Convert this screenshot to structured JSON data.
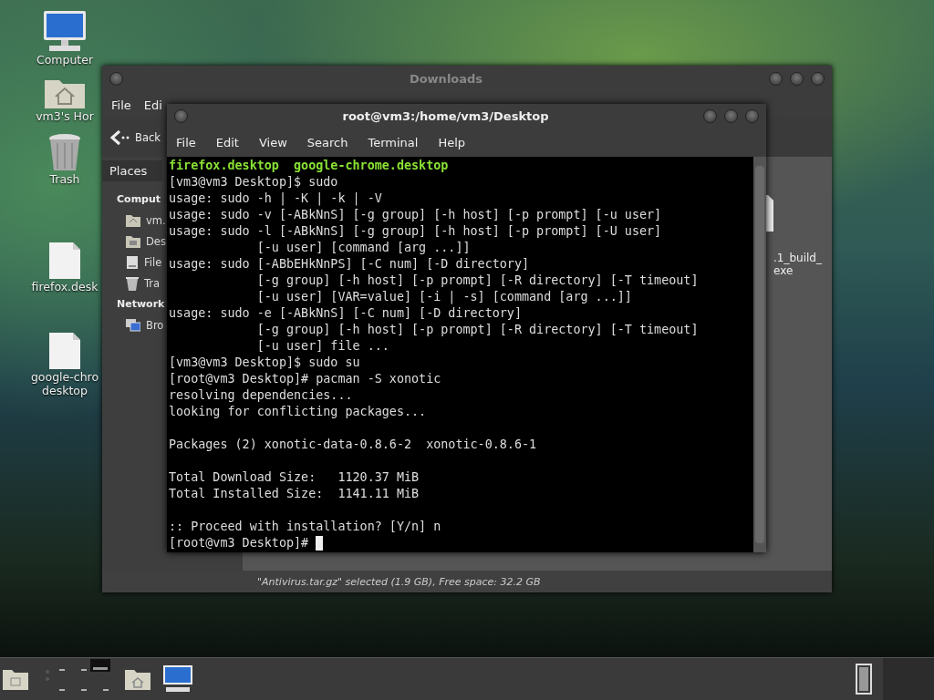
{
  "desktop_icons": [
    {
      "kind": "computer",
      "label": [
        "Computer"
      ]
    },
    {
      "kind": "home",
      "label": [
        "vm3's Hor"
      ]
    },
    {
      "kind": "trash",
      "label": [
        "Trash"
      ]
    },
    {
      "kind": "file",
      "label": [
        "firefox.desk"
      ]
    },
    {
      "kind": "file",
      "label": [
        "google-chro",
        "desktop"
      ]
    }
  ],
  "file_manager": {
    "title": "Downloads",
    "menu": [
      "File",
      "Edi"
    ],
    "back": "Back",
    "sidebar_tab": "Places",
    "sidebar": [
      {
        "kind": "heading",
        "label": "Comput"
      },
      {
        "kind": "home",
        "label": "vm."
      },
      {
        "kind": "desktop",
        "label": "Des"
      },
      {
        "kind": "drive",
        "label": "File"
      },
      {
        "kind": "trash",
        "label": "Tra"
      },
      {
        "kind": "heading",
        "label": "Network"
      },
      {
        "kind": "network",
        "label": "Bro"
      }
    ],
    "files": [
      {
        "label": [
          ".1_build_",
          "exe"
        ]
      }
    ],
    "status_bar": "\"Antivirus.tar.gz\" selected (1.9 GB), Free space: 32.2 GB"
  },
  "terminal": {
    "title": "root@vm3:/home/vm3/Desktop",
    "menu": [
      "File",
      "Edit",
      "View",
      "Search",
      "Terminal",
      "Help"
    ],
    "lines": [
      {
        "kind": "listing",
        "text": "firefox.desktop  google-chrome.desktop"
      },
      {
        "kind": "plain",
        "text": "[vm3@vm3 Desktop]$ sudo"
      },
      {
        "kind": "plain",
        "text": "usage: sudo -h | -K | -k | -V"
      },
      {
        "kind": "plain",
        "text": "usage: sudo -v [-ABkNnS] [-g group] [-h host] [-p prompt] [-u user]"
      },
      {
        "kind": "plain",
        "text": "usage: sudo -l [-ABkNnS] [-g group] [-h host] [-p prompt] [-U user]"
      },
      {
        "kind": "plain",
        "text": "            [-u user] [command [arg ...]]"
      },
      {
        "kind": "plain",
        "text": "usage: sudo [-ABbEHkNnPS] [-C num] [-D directory]"
      },
      {
        "kind": "plain",
        "text": "            [-g group] [-h host] [-p prompt] [-R directory] [-T timeout]"
      },
      {
        "kind": "plain",
        "text": "            [-u user] [VAR=value] [-i | -s] [command [arg ...]]"
      },
      {
        "kind": "plain",
        "text": "usage: sudo -e [-ABkNnS] [-C num] [-D directory]"
      },
      {
        "kind": "plain",
        "text": "            [-g group] [-h host] [-p prompt] [-R directory] [-T timeout]"
      },
      {
        "kind": "plain",
        "text": "            [-u user] file ..."
      },
      {
        "kind": "plain",
        "text": "[vm3@vm3 Desktop]$ sudo su"
      },
      {
        "kind": "plain",
        "text": "[root@vm3 Desktop]# pacman -S xonotic"
      },
      {
        "kind": "plain",
        "text": "resolving dependencies..."
      },
      {
        "kind": "plain",
        "text": "looking for conflicting packages..."
      },
      {
        "kind": "blank"
      },
      {
        "kind": "plain",
        "text": "Packages (2) xonotic-data-0.8.6-2  xonotic-0.8.6-1"
      },
      {
        "kind": "blank"
      },
      {
        "kind": "plain",
        "text": "Total Download Size:   1120.37 MiB"
      },
      {
        "kind": "plain",
        "text": "Total Installed Size:  1141.11 MiB"
      },
      {
        "kind": "blank"
      },
      {
        "kind": "plain",
        "text": ":: Proceed with installation? [Y/n] n"
      },
      {
        "kind": "prompt",
        "text": "[root@vm3 Desktop]#"
      }
    ]
  },
  "taskbar": [
    {
      "kind": "drive-folder"
    },
    {
      "kind": "switcher"
    },
    {
      "kind": "home"
    },
    {
      "kind": "computer"
    }
  ]
}
